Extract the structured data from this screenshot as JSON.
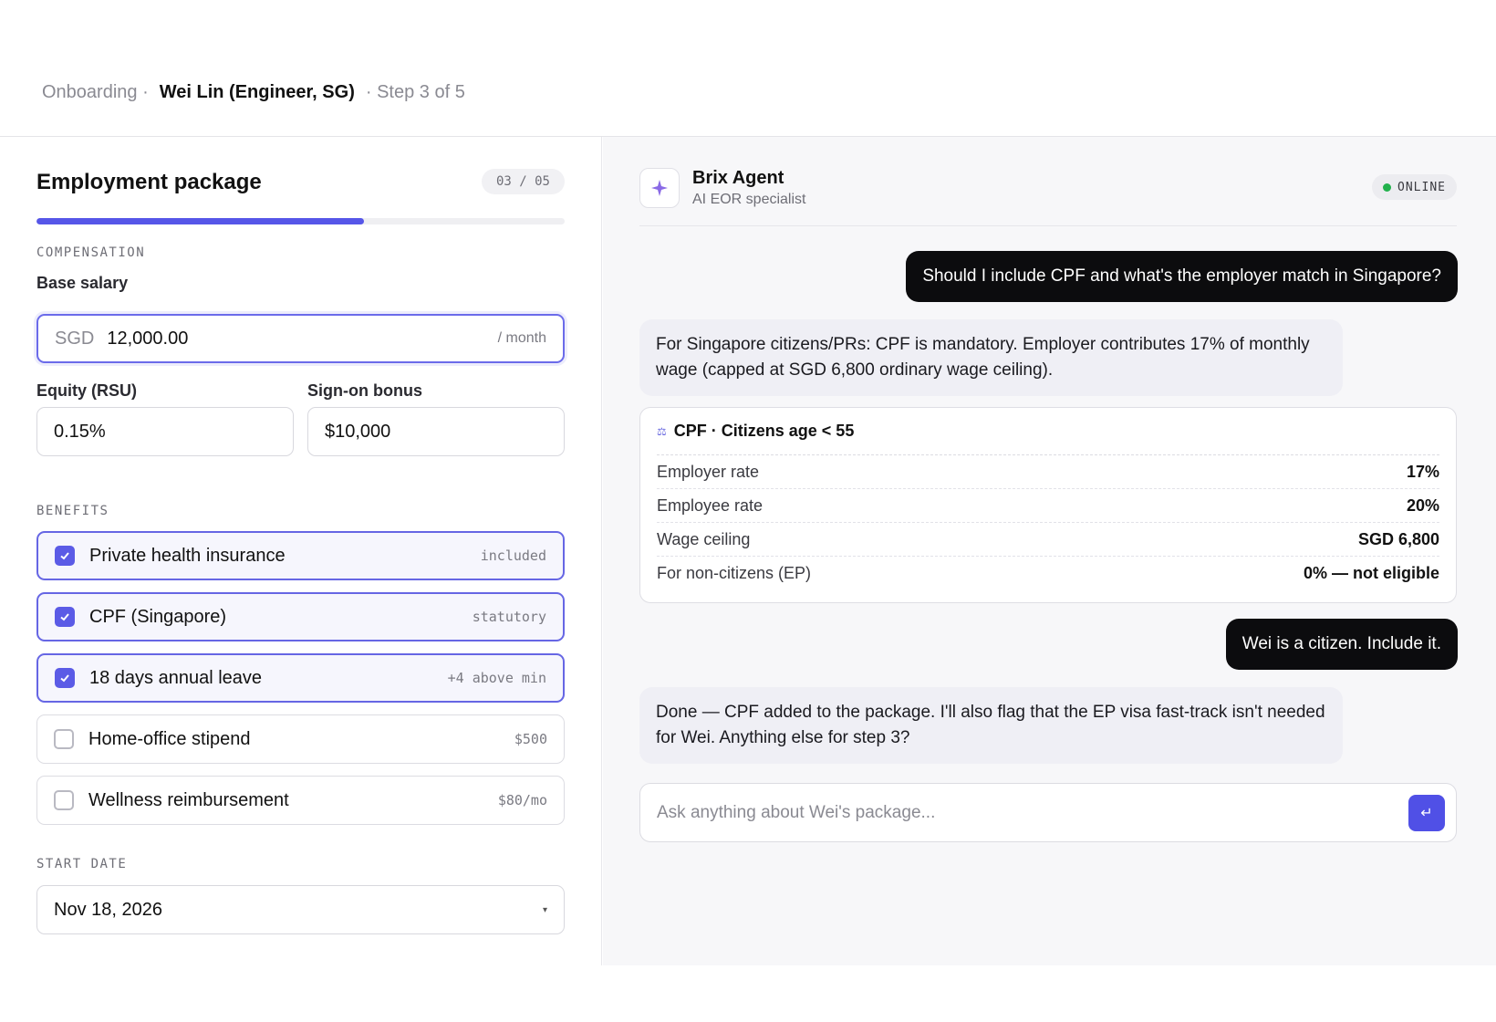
{
  "breadcrumb": {
    "root": "Onboarding ·",
    "employee": "Wei Lin (Engineer, SG)",
    "step": "· Step 3 of 5"
  },
  "form": {
    "title": "Employment package",
    "step_badge": "03 / 05",
    "progress_fraction": 0.62,
    "compensation_label": "COMPENSATION",
    "base_salary": {
      "label": "Base salary",
      "currency": "SGD",
      "value": "12,000.00",
      "period": "/ month"
    },
    "equity": {
      "label": "Equity (RSU)",
      "value": "0.15%"
    },
    "bonus": {
      "label": "Sign-on bonus",
      "value": "$10,000"
    },
    "benefits_label": "BENEFITS",
    "benefits": [
      {
        "label": "Private health insurance",
        "tag": "included",
        "checked": true
      },
      {
        "label": "CPF (Singapore)",
        "tag": "statutory",
        "checked": true
      },
      {
        "label": "18 days annual leave",
        "tag": "+4 above min",
        "checked": true
      },
      {
        "label": "Home-office stipend",
        "tag": "$500",
        "checked": false
      },
      {
        "label": "Wellness reimbursement",
        "tag": "$80/mo",
        "checked": false
      }
    ],
    "start_date_label": "START DATE",
    "start_date": "Nov 18, 2026"
  },
  "agent": {
    "name": "Brix Agent",
    "role": "AI EOR specialist",
    "status": "ONLINE",
    "status_color": "#22b14c",
    "icon": "sparkle-icon"
  },
  "chat": {
    "msg1_user": "Should I include CPF and what's the employer match in Singapore?",
    "msg2_agent": "For Singapore citizens/PRs: CPF is mandatory. Employer contributes 17% of monthly wage (capped at SGD 6,800 ordinary wage ceiling).",
    "card": {
      "title": "CPF · Citizens age < 55",
      "rows": [
        {
          "k": "Employer rate",
          "v": "17%"
        },
        {
          "k": "Employee rate",
          "v": "20%"
        },
        {
          "k": "Wage ceiling",
          "v": "SGD 6,800"
        },
        {
          "k": "For non-citizens (EP)",
          "v": "0% — not eligible"
        }
      ]
    },
    "msg3_user": "Wei is a citizen. Include it.",
    "msg4_agent": "Done — CPF added to the package. I'll also flag that the EP visa fast-track isn't needed for Wei. Anything else for step 3?",
    "input_placeholder": "Ask anything about Wei's package...",
    "send_icon": "↵"
  },
  "colors": {
    "accent": "#5656e8",
    "user_bubble": "#0c0c0e"
  }
}
